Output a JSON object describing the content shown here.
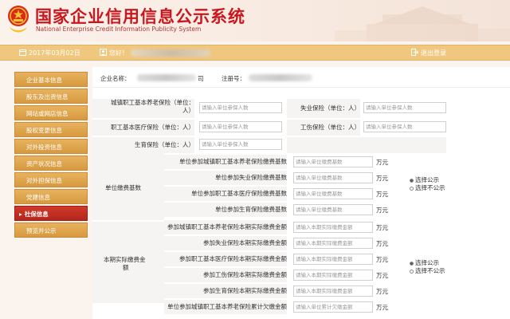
{
  "header": {
    "title_cn": "国家企业信用信息公示系统",
    "title_en": "National Enterprise Credit Information Publicity System"
  },
  "infobar": {
    "date": "2017年03月02日",
    "hello_prefix": "您好！",
    "logout": "退出登录"
  },
  "sidebar": {
    "items": [
      {
        "label": "企业基本信息"
      },
      {
        "label": "股东及出资信息"
      },
      {
        "label": "网站或网店信息"
      },
      {
        "label": "股权变更信息"
      },
      {
        "label": "对外投资信息"
      },
      {
        "label": "资产状况信息"
      },
      {
        "label": "对外担保信息"
      },
      {
        "label": "党建信息"
      },
      {
        "label": "社保信息"
      },
      {
        "label": "预览并公示"
      }
    ]
  },
  "company": {
    "name_label": "企业名称：",
    "name_prefix": "",
    "name_suffix": "司",
    "reg_label": "注册号："
  },
  "form": {
    "insured_rows": [
      {
        "left_label_1": "城镇职工基本养老保险（单位：",
        "left_label_2": "人）",
        "left_placeholder": "请输入单位参保人数",
        "right_label": "失业保险（单位：人）",
        "right_placeholder": "请输入单位参保人数"
      },
      {
        "left_label_1": "职工基本医疗保险（单位：人）",
        "left_label_2": "",
        "left_placeholder": "请输入单位参保人数",
        "right_label": "工伤保险（单位：人）",
        "right_placeholder": "请输入单位参保人数"
      },
      {
        "left_label_1": "生育保险（单位：人）",
        "left_label_2": "",
        "left_placeholder": "请输入单位参保人数"
      }
    ],
    "base_group": {
      "label": "单位缴费基数",
      "rows": [
        {
          "label": "单位参加城镇职工基本养老保险缴费基数",
          "placeholder": "请输入单位缴费基数",
          "unit": "万元"
        },
        {
          "label": "单位参加失业保险缴费基数",
          "placeholder": "请输入单位缴费基数",
          "unit": "万元"
        },
        {
          "label": "单位参加职工基本医疗保险缴费基数",
          "placeholder": "请输入单位缴费基数",
          "unit": "万元"
        },
        {
          "label": "单位参加生育保险缴费基数",
          "placeholder": "请输入单位缴费基数",
          "unit": "万元"
        }
      ],
      "radio_public": "选择公示",
      "radio_private": "选择不公示"
    },
    "paid_group": {
      "label_1": "本期实际缴费金",
      "label_2": "额",
      "rows": [
        {
          "label": "参加城镇职工基本养老保险本期实际缴费金额",
          "placeholder": "请输入本期实际缴费金额",
          "unit": "万元"
        },
        {
          "label": "参加失业保险本期实际缴费金额",
          "placeholder": "请输入本期实际缴费金额",
          "unit": "万元"
        },
        {
          "label": "参加职工基本医疗保险本期实际缴费金额",
          "placeholder": "请输入本期实际缴费金额",
          "unit": "万元"
        },
        {
          "label": "参加工伤保险本期实际缴费金额",
          "placeholder": "请输入本期实际缴费金额",
          "unit": "万元"
        },
        {
          "label": "参加生育保险本期实际缴费金额",
          "placeholder": "请输入本期实际缴费金额",
          "unit": "万元"
        }
      ],
      "radio_public": "选择公示",
      "radio_private": "选择不公示"
    },
    "arrears_row": {
      "label": "单位参加城镇职工基本养老保险累计欠缴金额",
      "placeholder": "请输入单位累计欠缴金额",
      "unit": "万元"
    }
  },
  "colors": {
    "brand_red": "#c8171e",
    "sidebar_gold": "#e0a84f",
    "sidebar_active": "#c12e22",
    "infobar": "#f0c77e"
  }
}
